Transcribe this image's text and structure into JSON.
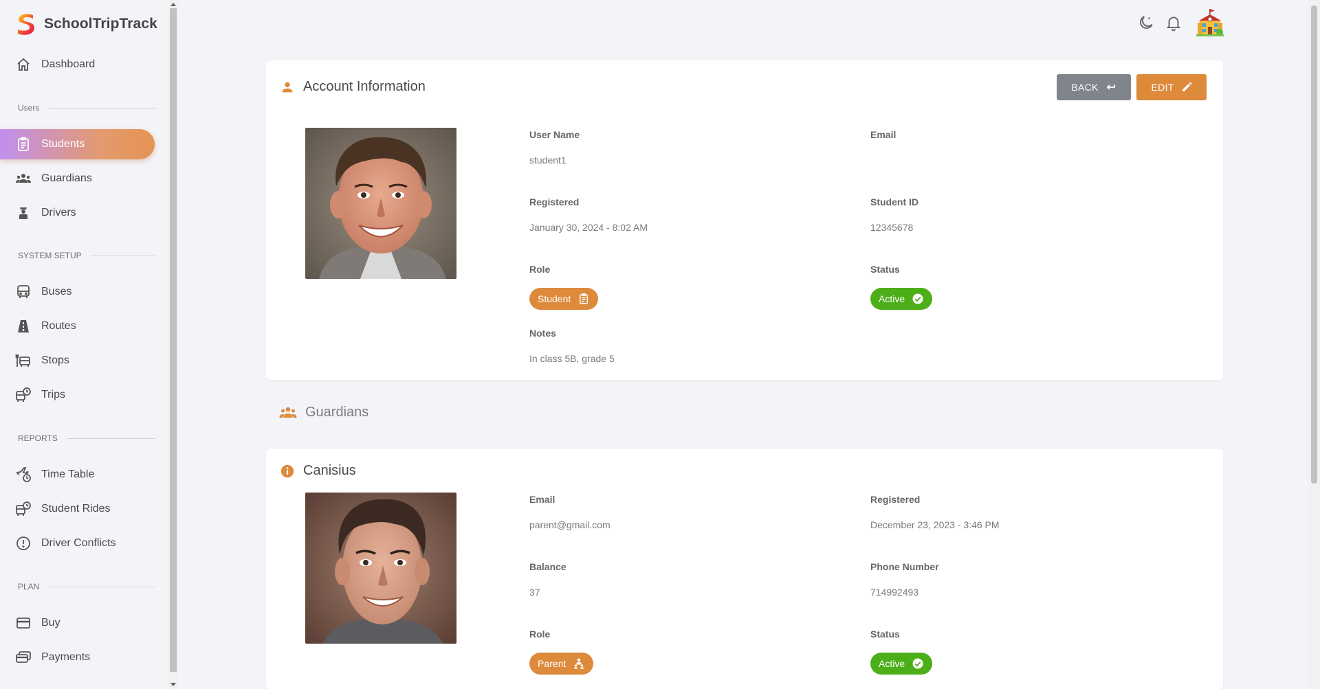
{
  "app": {
    "name": "SchoolTripTrack"
  },
  "sidebar": {
    "dashboard": "Dashboard",
    "sections": {
      "users": "Users",
      "system_setup": "SYSTEM SETUP",
      "reports": "REPORTS",
      "plan": "PLAN"
    },
    "items": {
      "students": "Students",
      "guardians": "Guardians",
      "drivers": "Drivers",
      "buses": "Buses",
      "routes": "Routes",
      "stops": "Stops",
      "trips": "Trips",
      "time_table": "Time Table",
      "student_rides": "Student Rides",
      "driver_conflicts": "Driver Conflicts",
      "buy": "Buy",
      "payments": "Payments"
    },
    "active": "students"
  },
  "topbar": {
    "icons": [
      "theme-moon-icon",
      "notification-bell-icon",
      "school-avatar"
    ]
  },
  "account": {
    "title": "Account Information",
    "back_label": "BACK",
    "edit_label": "EDIT",
    "fields": {
      "username_label": "User Name",
      "username": "student1",
      "email_label": "Email",
      "email": "",
      "registered_label": "Registered",
      "registered": "January 30, 2024 - 8:02 AM",
      "student_id_label": "Student ID",
      "student_id": "12345678",
      "role_label": "Role",
      "role": "Student",
      "status_label": "Status",
      "status": "Active",
      "notes_label": "Notes",
      "notes": "In class 5B, grade 5"
    }
  },
  "guardians_heading": "Guardians",
  "guardian": {
    "name": "Canisius",
    "email_label": "Email",
    "email": "parent@gmail.com",
    "registered_label": "Registered",
    "registered": "December 23, 2023 - 3:46 PM",
    "balance_label": "Balance",
    "balance": "37",
    "phone_label": "Phone Number",
    "phone": "714992493",
    "role_label": "Role",
    "role": "Parent",
    "status_label": "Status",
    "status": "Active"
  },
  "colors": {
    "accent": "#dd8a3b",
    "active_green": "#4caf19",
    "back_gray": "#80848b",
    "background": "#f3f4f8"
  }
}
